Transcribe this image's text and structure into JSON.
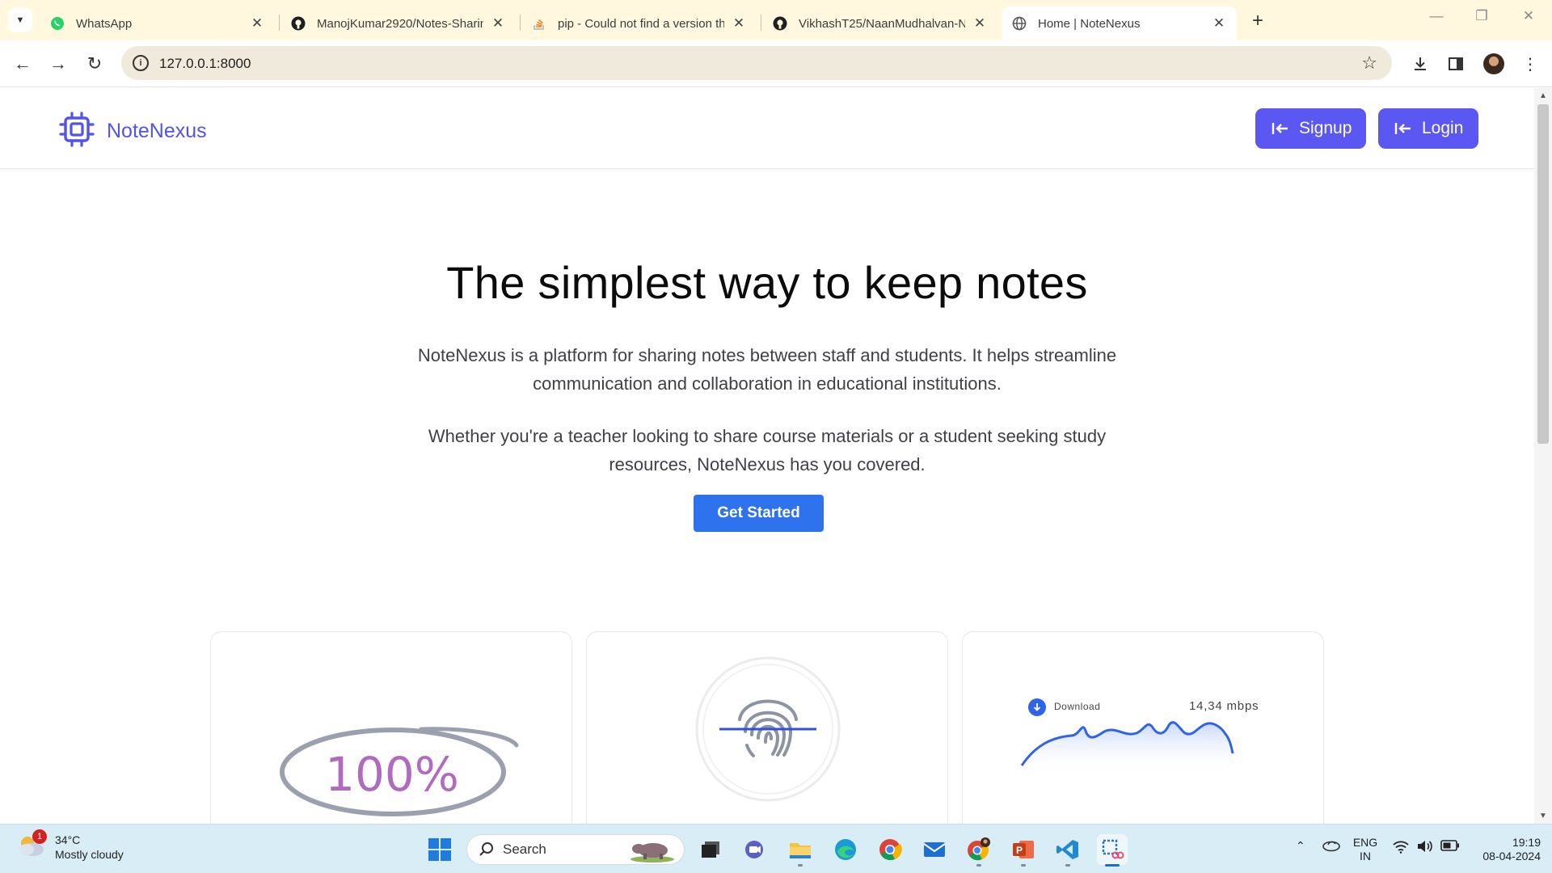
{
  "browser": {
    "tabs": [
      {
        "title": "WhatsApp",
        "icon": "whatsapp-icon",
        "active": false
      },
      {
        "title": "ManojKumar2920/Notes-Sharin",
        "icon": "github-icon",
        "active": false
      },
      {
        "title": "pip - Could not find a version th",
        "icon": "stackoverflow-icon",
        "active": false
      },
      {
        "title": "VikhashT25/NaanMudhalvan-N",
        "icon": "github-icon",
        "active": false
      },
      {
        "title": "Home | NoteNexus",
        "icon": "globe-icon",
        "active": true
      }
    ],
    "url": "127.0.0.1:8000"
  },
  "site": {
    "brand": "NoteNexus",
    "signup_label": "Signup",
    "login_label": "Login",
    "hero_title": "The simplest way to keep notes",
    "hero_p1": "NoteNexus is a platform for sharing notes between staff and students. It helps streamline communication and collaboration in educational institutions.",
    "hero_p2": "Whether you're a teacher looking to share course materials or a student seeking study resources, NoteNexus has you covered.",
    "cta_label": "Get Started",
    "cards": {
      "percent": "100%",
      "download_label": "Download",
      "download_speed": "14,34 mbps"
    },
    "colors": {
      "brand": "#5254e6",
      "button": "#5b57f2",
      "cta": "#2f72ee"
    }
  },
  "taskbar": {
    "weather_temp": "34°C",
    "weather_desc": "Mostly cloudy",
    "weather_alerts": "1",
    "search_label": "Search",
    "lang_line1": "ENG",
    "lang_line2": "IN",
    "time": "19:19",
    "date": "08-04-2024"
  }
}
